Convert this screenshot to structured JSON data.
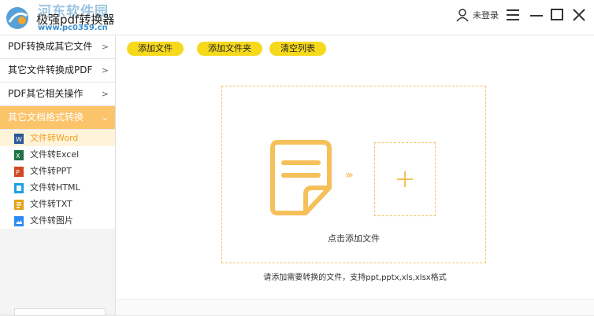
{
  "app": {
    "title": "极强pdf转换器",
    "watermark": "河东软件园",
    "watermark_url": "www.pc0359.cn",
    "user_label": "未登录"
  },
  "sidebar": {
    "categories": [
      {
        "label": "PDF转换成其它文件",
        "arrow": ">"
      },
      {
        "label": "其它文件转换成PDF",
        "arrow": ">"
      },
      {
        "label": "PDF其它相关操作",
        "arrow": ">"
      },
      {
        "label": "其它文档格式转换",
        "arrow": "⌄"
      }
    ],
    "items": [
      {
        "label": "文件转Word",
        "icon": "word-icon",
        "color": "#2b5797"
      },
      {
        "label": "文件转Excel",
        "icon": "excel-icon",
        "color": "#1e7145"
      },
      {
        "label": "文件转PPT",
        "icon": "ppt-icon",
        "color": "#d24726"
      },
      {
        "label": "文件转HTML",
        "icon": "html-icon",
        "color": "#1ba1e2"
      },
      {
        "label": "文件转TXT",
        "icon": "txt-icon",
        "color": "#e3a21a"
      },
      {
        "label": "文件转图片",
        "icon": "image-icon",
        "color": "#2d89ef"
      }
    ]
  },
  "toolbar": {
    "add_file": "添加文件",
    "add_folder": "添加文件夹",
    "clear_list": "清空列表"
  },
  "dropzone": {
    "label": "点击添加文件",
    "hint": "请添加需要转换的文件，支持ppt,pptx,xls,xlsx格式"
  },
  "colors": {
    "accent": "#fbc46b",
    "button": "#f7d91c",
    "icon": "#f5c059"
  }
}
